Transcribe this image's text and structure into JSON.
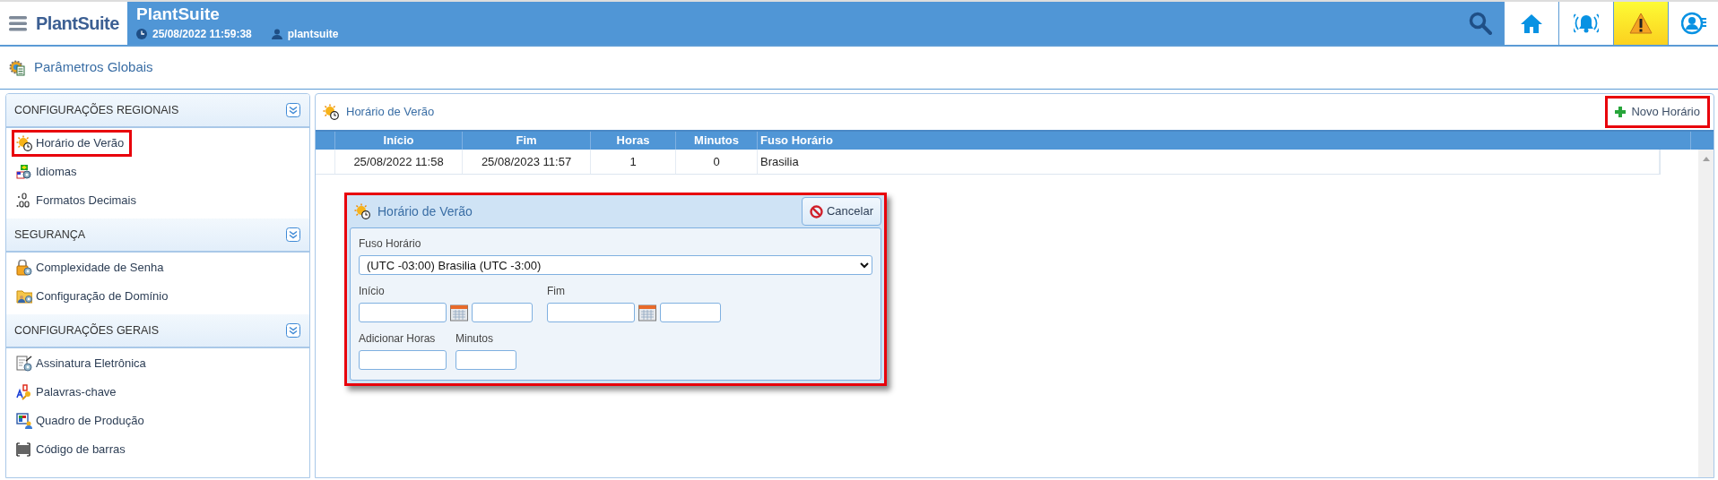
{
  "header": {
    "logo": "PlantSuite",
    "title": "PlantSuite",
    "datetime": "25/08/2022 11:59:38",
    "user": "plantsuite",
    "alert_active": true
  },
  "breadcrumb": "Parâmetros Globais",
  "sidebar": {
    "sections": [
      {
        "title": "CONFIGURAÇÕES REGIONAIS",
        "items": [
          {
            "label": "Horário de Verão",
            "highlighted": true
          },
          {
            "label": "Idiomas",
            "highlighted": false
          },
          {
            "label": "Formatos Decimais",
            "highlighted": false
          }
        ]
      },
      {
        "title": "SEGURANÇA",
        "items": [
          {
            "label": "Complexidade de Senha",
            "highlighted": false
          },
          {
            "label": "Configuração de Domínio",
            "highlighted": false
          }
        ]
      },
      {
        "title": "CONFIGURAÇÕES GERAIS",
        "items": [
          {
            "label": "Assinatura Eletrônica",
            "highlighted": false
          },
          {
            "label": "Palavras-chave",
            "highlighted": false
          },
          {
            "label": "Quadro de Produção",
            "highlighted": false
          },
          {
            "label": "Código de barras",
            "highlighted": false
          }
        ]
      }
    ]
  },
  "panel": {
    "title": "Horário de Verão",
    "new_button": {
      "label": "Novo Horário",
      "highlighted": true
    },
    "table": {
      "columns": [
        "Início",
        "Fim",
        "Horas",
        "Minutos",
        "Fuso Horário"
      ],
      "rows": [
        {
          "cells": [
            "25/08/2022 11:58",
            "25/08/2023 11:57",
            "1",
            "0",
            "Brasilia"
          ]
        }
      ]
    }
  },
  "dialog": {
    "title": "Horário de Verão",
    "highlighted": true,
    "cancel_label": "Cancelar",
    "timezone": {
      "label": "Fuso Horário",
      "value": "(UTC -03:00) Brasilia (UTC -3:00)"
    },
    "start_label": "Início",
    "end_label": "Fim",
    "add_hours_label": "Adicionar Horas",
    "minutes_label": "Minutos"
  }
}
